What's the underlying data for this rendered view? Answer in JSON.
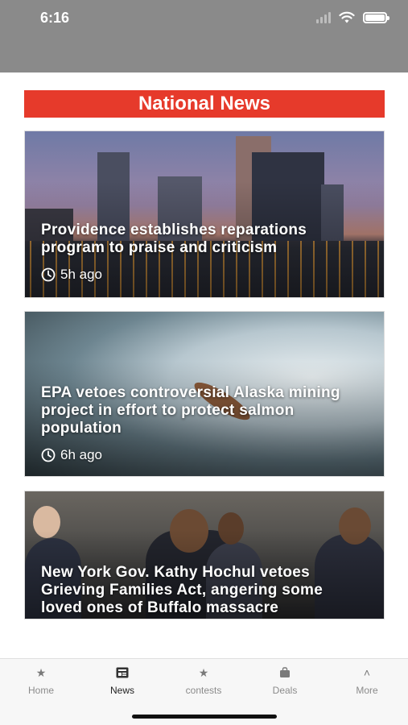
{
  "status_bar": {
    "time": "6:16"
  },
  "section": {
    "title": "National News"
  },
  "articles": [
    {
      "title": "Providence establishes reparations program to praise and criticism",
      "time": "5h ago"
    },
    {
      "title": "EPA vetoes controversial Alaska mining project in effort to protect salmon population",
      "time": "6h ago"
    },
    {
      "title": "New York Gov. Kathy Hochul vetoes Grieving Families Act, angering some loved ones of Buffalo massacre",
      "time": ""
    }
  ],
  "nav": {
    "items": [
      {
        "label": "Home",
        "icon": "star-icon"
      },
      {
        "label": "News",
        "icon": "newspaper-icon",
        "active": true
      },
      {
        "label": "contests",
        "icon": "star-icon"
      },
      {
        "label": "Deals",
        "icon": "bag-icon"
      },
      {
        "label": "More",
        "icon": "chevron-up-icon"
      }
    ]
  },
  "colors": {
    "accent": "#e63a2b",
    "status_bar": "#8a8a8a"
  }
}
